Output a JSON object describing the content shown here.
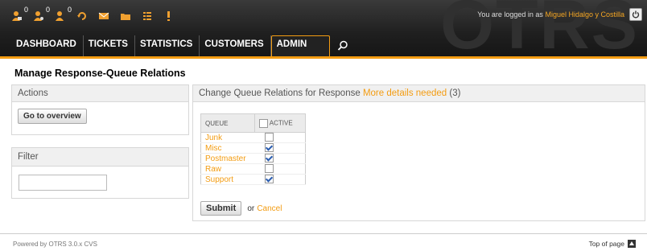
{
  "header": {
    "logo_text": "OTRS",
    "toolbar_counts": [
      "0",
      "0",
      "0"
    ],
    "login_prefix": "You are logged in as",
    "login_user": "Miguel Hidalgo y Costilla",
    "nav": [
      "DASHBOARD",
      "TICKETS",
      "STATISTICS",
      "CUSTOMERS",
      "ADMIN"
    ]
  },
  "page": {
    "title": "Manage Response-Queue Relations"
  },
  "actions": {
    "heading": "Actions",
    "overview_button": "Go to overview"
  },
  "filter": {
    "heading": "Filter",
    "value": ""
  },
  "main": {
    "heading_prefix": "Change Queue Relations for Response",
    "response_name": "More details needed",
    "response_id": "(3)",
    "col_queue": "QUEUE",
    "col_active": "ACTIVE",
    "rows": [
      {
        "queue": "Junk",
        "active": false
      },
      {
        "queue": "Misc",
        "active": true
      },
      {
        "queue": "Postmaster",
        "active": true
      },
      {
        "queue": "Raw",
        "active": false
      },
      {
        "queue": "Support",
        "active": true
      }
    ],
    "submit_label": "Submit",
    "or_text": "or",
    "cancel_label": "Cancel"
  },
  "footer": {
    "powered": "Powered by OTRS 3.0.x CVS",
    "top": "Top of page"
  },
  "colors": {
    "accent": "#f39c12",
    "header_bg": "#1f1f1f"
  }
}
